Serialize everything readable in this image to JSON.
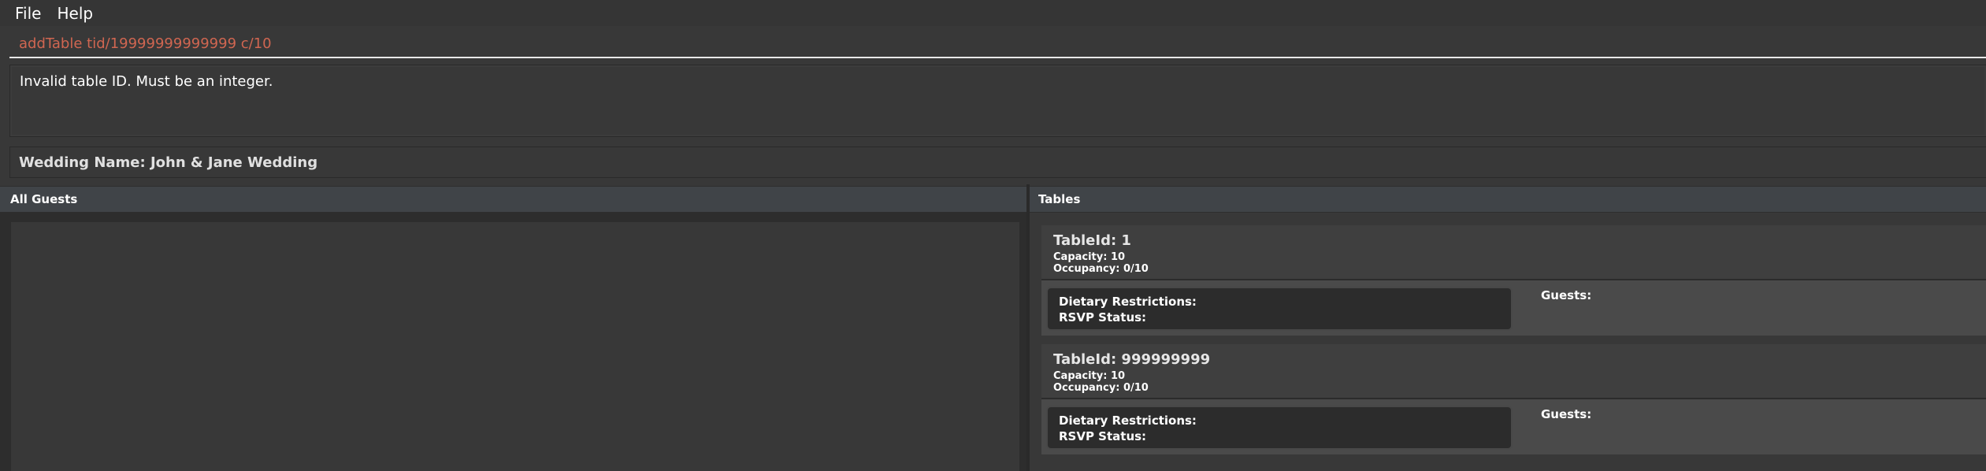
{
  "menu": {
    "file": "File",
    "help": "Help"
  },
  "command": {
    "value": "addTable tid/19999999999999 c/10"
  },
  "result": {
    "message": "Invalid table ID. Must be an integer."
  },
  "wedding": {
    "name": "Wedding Name: John & Jane Wedding"
  },
  "panels": {
    "guests_header": "All Guests",
    "tables_header": "Tables"
  },
  "tables": [
    {
      "table_id": "TableId: 1",
      "capacity": "Capacity: 10",
      "occupancy": "Occupancy: 0/10",
      "dietary": "Dietary Restrictions:",
      "rsvp": "RSVP Status:",
      "guests": "Guests:"
    },
    {
      "table_id": "TableId: 999999999",
      "capacity": "Capacity: 10",
      "occupancy": "Occupancy: 0/10",
      "dietary": "Dietary Restrictions:",
      "rsvp": "RSVP Status:",
      "guests": "Guests:"
    }
  ],
  "colors": {
    "command_text": "#d06651",
    "background": "#383838",
    "header_bg": "#404448"
  }
}
